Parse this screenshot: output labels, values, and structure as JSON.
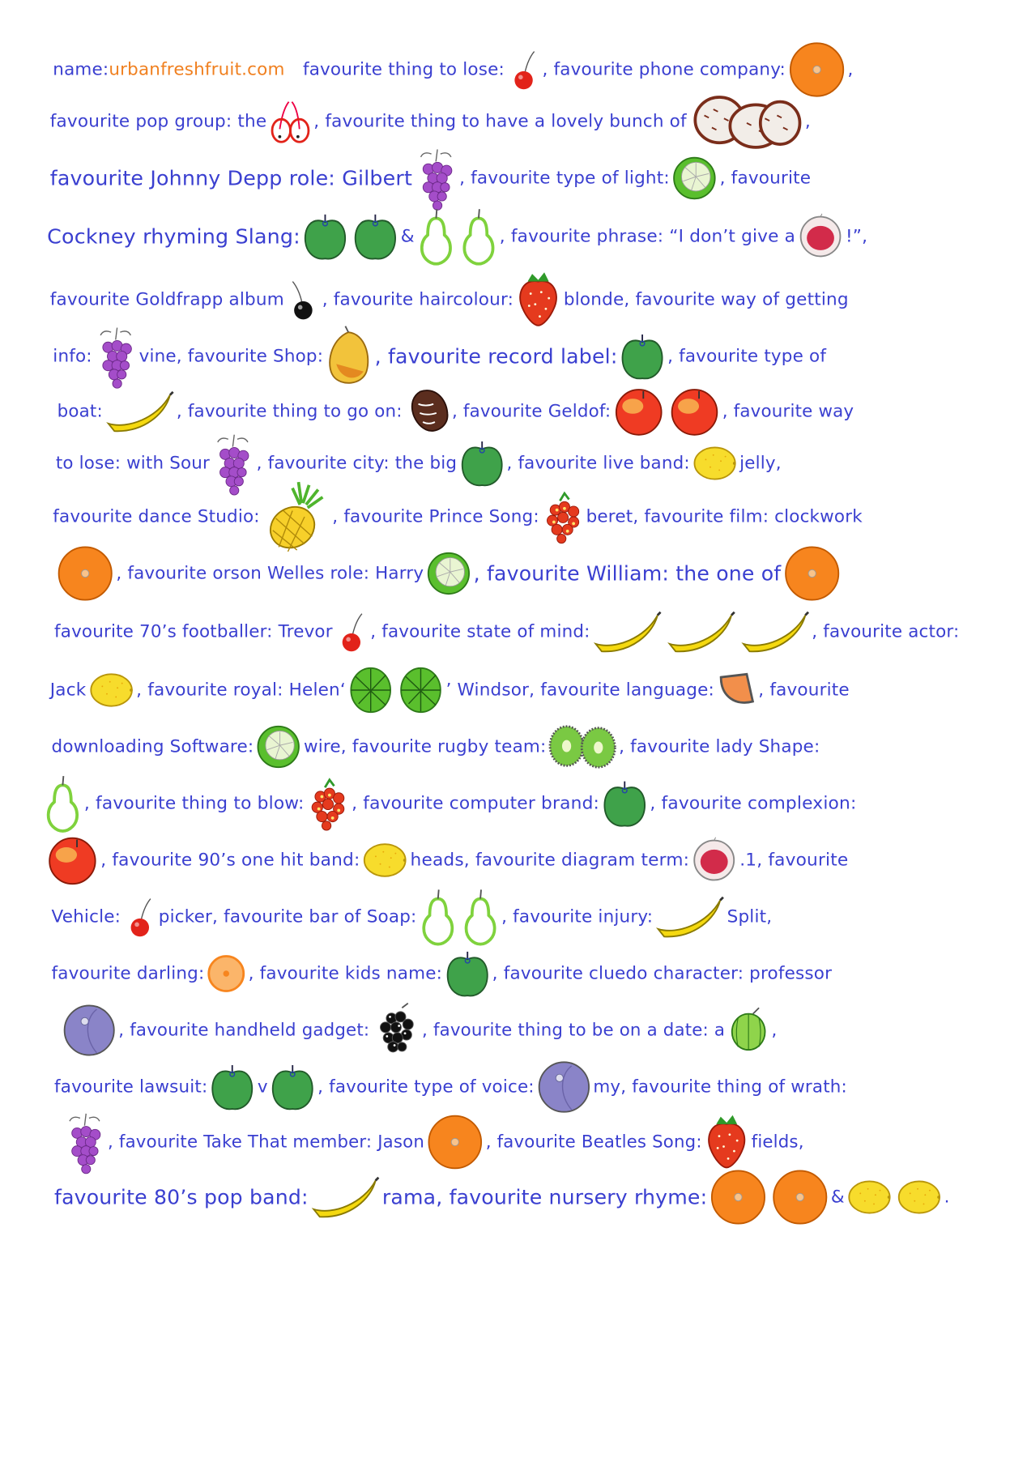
{
  "site": "urbanfreshfruit.com",
  "colors": {
    "ink": "#3a3fd0",
    "site": "#f08020",
    "cherry": "#e2231a",
    "orange": "#f7851e",
    "apple": "#3fa24a",
    "pear": "#7fd23d",
    "grape": "#a44dc9",
    "banana": "#f5d90f",
    "lemon": "#f7dc2c",
    "lime": "#5abf2d",
    "strawberry": "#e53a1e",
    "plum": "#8a84c8"
  },
  "lines": [
    [
      {
        "t": "name:"
      },
      {
        "t": "urbanfreshfruit.com",
        "c": "orange",
        "gap": 1
      },
      {
        "t": "favourite thing to lose:"
      },
      {
        "f": "cherry"
      },
      {
        "t": ", favourite phone company:"
      },
      {
        "f": "orange"
      },
      {
        "t": ","
      }
    ],
    [
      {
        "t": "favourite pop group: the"
      },
      {
        "f": "cherries"
      },
      {
        "t": ", favourite thing to have a lovely bunch of"
      },
      {
        "f": "coconuts"
      },
      {
        "t": ","
      }
    ],
    [
      {
        "t": "favourite Johnny Depp role: Gilbert",
        "c": "big"
      },
      {
        "f": "grapes"
      },
      {
        "t": ", favourite type of light:"
      },
      {
        "f": "lime"
      },
      {
        "t": ", favourite"
      }
    ],
    [
      {
        "t": "Cockney rhyming Slang:",
        "c": "big"
      },
      {
        "f": "apple"
      },
      {
        "f": "apple"
      },
      {
        "t": "&"
      },
      {
        "f": "pear"
      },
      {
        "f": "pear"
      },
      {
        "t": ", favourite phrase: “I don’t give a"
      },
      {
        "f": "fig"
      },
      {
        "t": "!”,"
      }
    ],
    [
      {
        "t": "favourite Goldfrapp album"
      },
      {
        "f": "blackcherry"
      },
      {
        "t": ", favourite haircolour:"
      },
      {
        "f": "strawberry"
      },
      {
        "t": "blonde, favourite way of getting"
      }
    ],
    [
      {
        "t": "info:"
      },
      {
        "f": "grapes"
      },
      {
        "t": "vine, favourite Shop:"
      },
      {
        "f": "mango"
      },
      {
        "t": ", favourite record label:",
        "c": "big"
      },
      {
        "f": "apple"
      },
      {
        "t": ", favourite type of"
      }
    ],
    [
      {
        "t": "boat:"
      },
      {
        "f": "banana"
      },
      {
        "t": ", favourite thing to go on:"
      },
      {
        "f": "date"
      },
      {
        "t": ", favourite Geldof:"
      },
      {
        "f": "peach"
      },
      {
        "f": "peach"
      },
      {
        "t": ", favourite way"
      }
    ],
    [
      {
        "t": "to lose: with Sour"
      },
      {
        "f": "grapes"
      },
      {
        "t": ", favourite city: the big"
      },
      {
        "f": "apple"
      },
      {
        "t": ", favourite live band:"
      },
      {
        "f": "lemon"
      },
      {
        "t": "jelly,"
      }
    ],
    [
      {
        "t": "favourite dance Studio:"
      },
      {
        "f": "pineapple"
      },
      {
        "t": ", favourite Prince Song:"
      },
      {
        "f": "raspberry"
      },
      {
        "t": "beret, favourite film: clockwork"
      }
    ],
    [
      {
        "f": "orange"
      },
      {
        "t": ", favourite orson Welles role: Harry"
      },
      {
        "f": "lime"
      },
      {
        "t": ", favourite William: the one of",
        "c": "big"
      },
      {
        "f": "orange"
      }
    ],
    [
      {
        "t": "favourite 70’s footballer: Trevor"
      },
      {
        "f": "cherry"
      },
      {
        "t": ", favourite state of mind:"
      },
      {
        "f": "banana"
      },
      {
        "f": "banana"
      },
      {
        "f": "banana"
      },
      {
        "t": ", favourite actor:"
      }
    ],
    [
      {
        "t": "Jack"
      },
      {
        "f": "lemon"
      },
      {
        "t": ", favourite royal: Helen‘"
      },
      {
        "f": "melon"
      },
      {
        "f": "melon"
      },
      {
        "t": "’ Windsor, favourite language:"
      },
      {
        "f": "cantaloupe"
      },
      {
        "t": ", favourite"
      }
    ],
    [
      {
        "t": "downloading Software:"
      },
      {
        "f": "lime"
      },
      {
        "t": "wire, favourite rugby team:"
      },
      {
        "f": "kiwi"
      },
      {
        "t": ", favourite lady Shape:"
      }
    ],
    [
      {
        "f": "pear"
      },
      {
        "t": ", favourite thing to blow:"
      },
      {
        "f": "raspberry"
      },
      {
        "t": ", favourite computer brand:"
      },
      {
        "f": "apple"
      },
      {
        "t": ", favourite complexion:"
      }
    ],
    [
      {
        "f": "peach"
      },
      {
        "t": ", favourite 90’s one hit band:"
      },
      {
        "f": "lemon"
      },
      {
        "t": "heads, favourite diagram term:"
      },
      {
        "f": "fig"
      },
      {
        "t": ".1, favourite"
      }
    ],
    [
      {
        "t": "Vehicle:"
      },
      {
        "f": "cherry"
      },
      {
        "t": "picker, favourite bar of Soap:"
      },
      {
        "f": "pear"
      },
      {
        "f": "pear"
      },
      {
        "t": ", favourite injury:"
      },
      {
        "f": "banana"
      },
      {
        "t": "Split,"
      }
    ],
    [
      {
        "t": "favourite darling:"
      },
      {
        "f": "clementine"
      },
      {
        "t": ", favourite kids name:"
      },
      {
        "f": "apple"
      },
      {
        "t": ", favourite cluedo character: professor"
      }
    ],
    [
      {
        "f": "plum"
      },
      {
        "t": ", favourite handheld gadget:"
      },
      {
        "f": "blackberry"
      },
      {
        "t": ", favourite thing to be on a date: a"
      },
      {
        "f": "gooseberry"
      },
      {
        "t": ","
      }
    ],
    [
      {
        "t": "favourite lawsuit:"
      },
      {
        "f": "apple"
      },
      {
        "t": "v"
      },
      {
        "f": "apple"
      },
      {
        "t": ", favourite type of voice:"
      },
      {
        "f": "plum"
      },
      {
        "t": "my, favourite thing of wrath:"
      }
    ],
    [
      {
        "f": "grapes"
      },
      {
        "t": ", favourite Take That member: Jason"
      },
      {
        "f": "orange"
      },
      {
        "t": ", favourite Beatles Song:"
      },
      {
        "f": "strawberry"
      },
      {
        "t": "fields,"
      }
    ],
    [
      {
        "t": "favourite 80’s pop band:",
        "c": "big"
      },
      {
        "f": "banana"
      },
      {
        "t": "rama, favourite nursery rhyme:",
        "c": "big"
      },
      {
        "f": "orange"
      },
      {
        "f": "orange"
      },
      {
        "t": "&"
      },
      {
        "f": "lemon"
      },
      {
        "f": "lemon"
      },
      {
        "t": "."
      }
    ]
  ]
}
